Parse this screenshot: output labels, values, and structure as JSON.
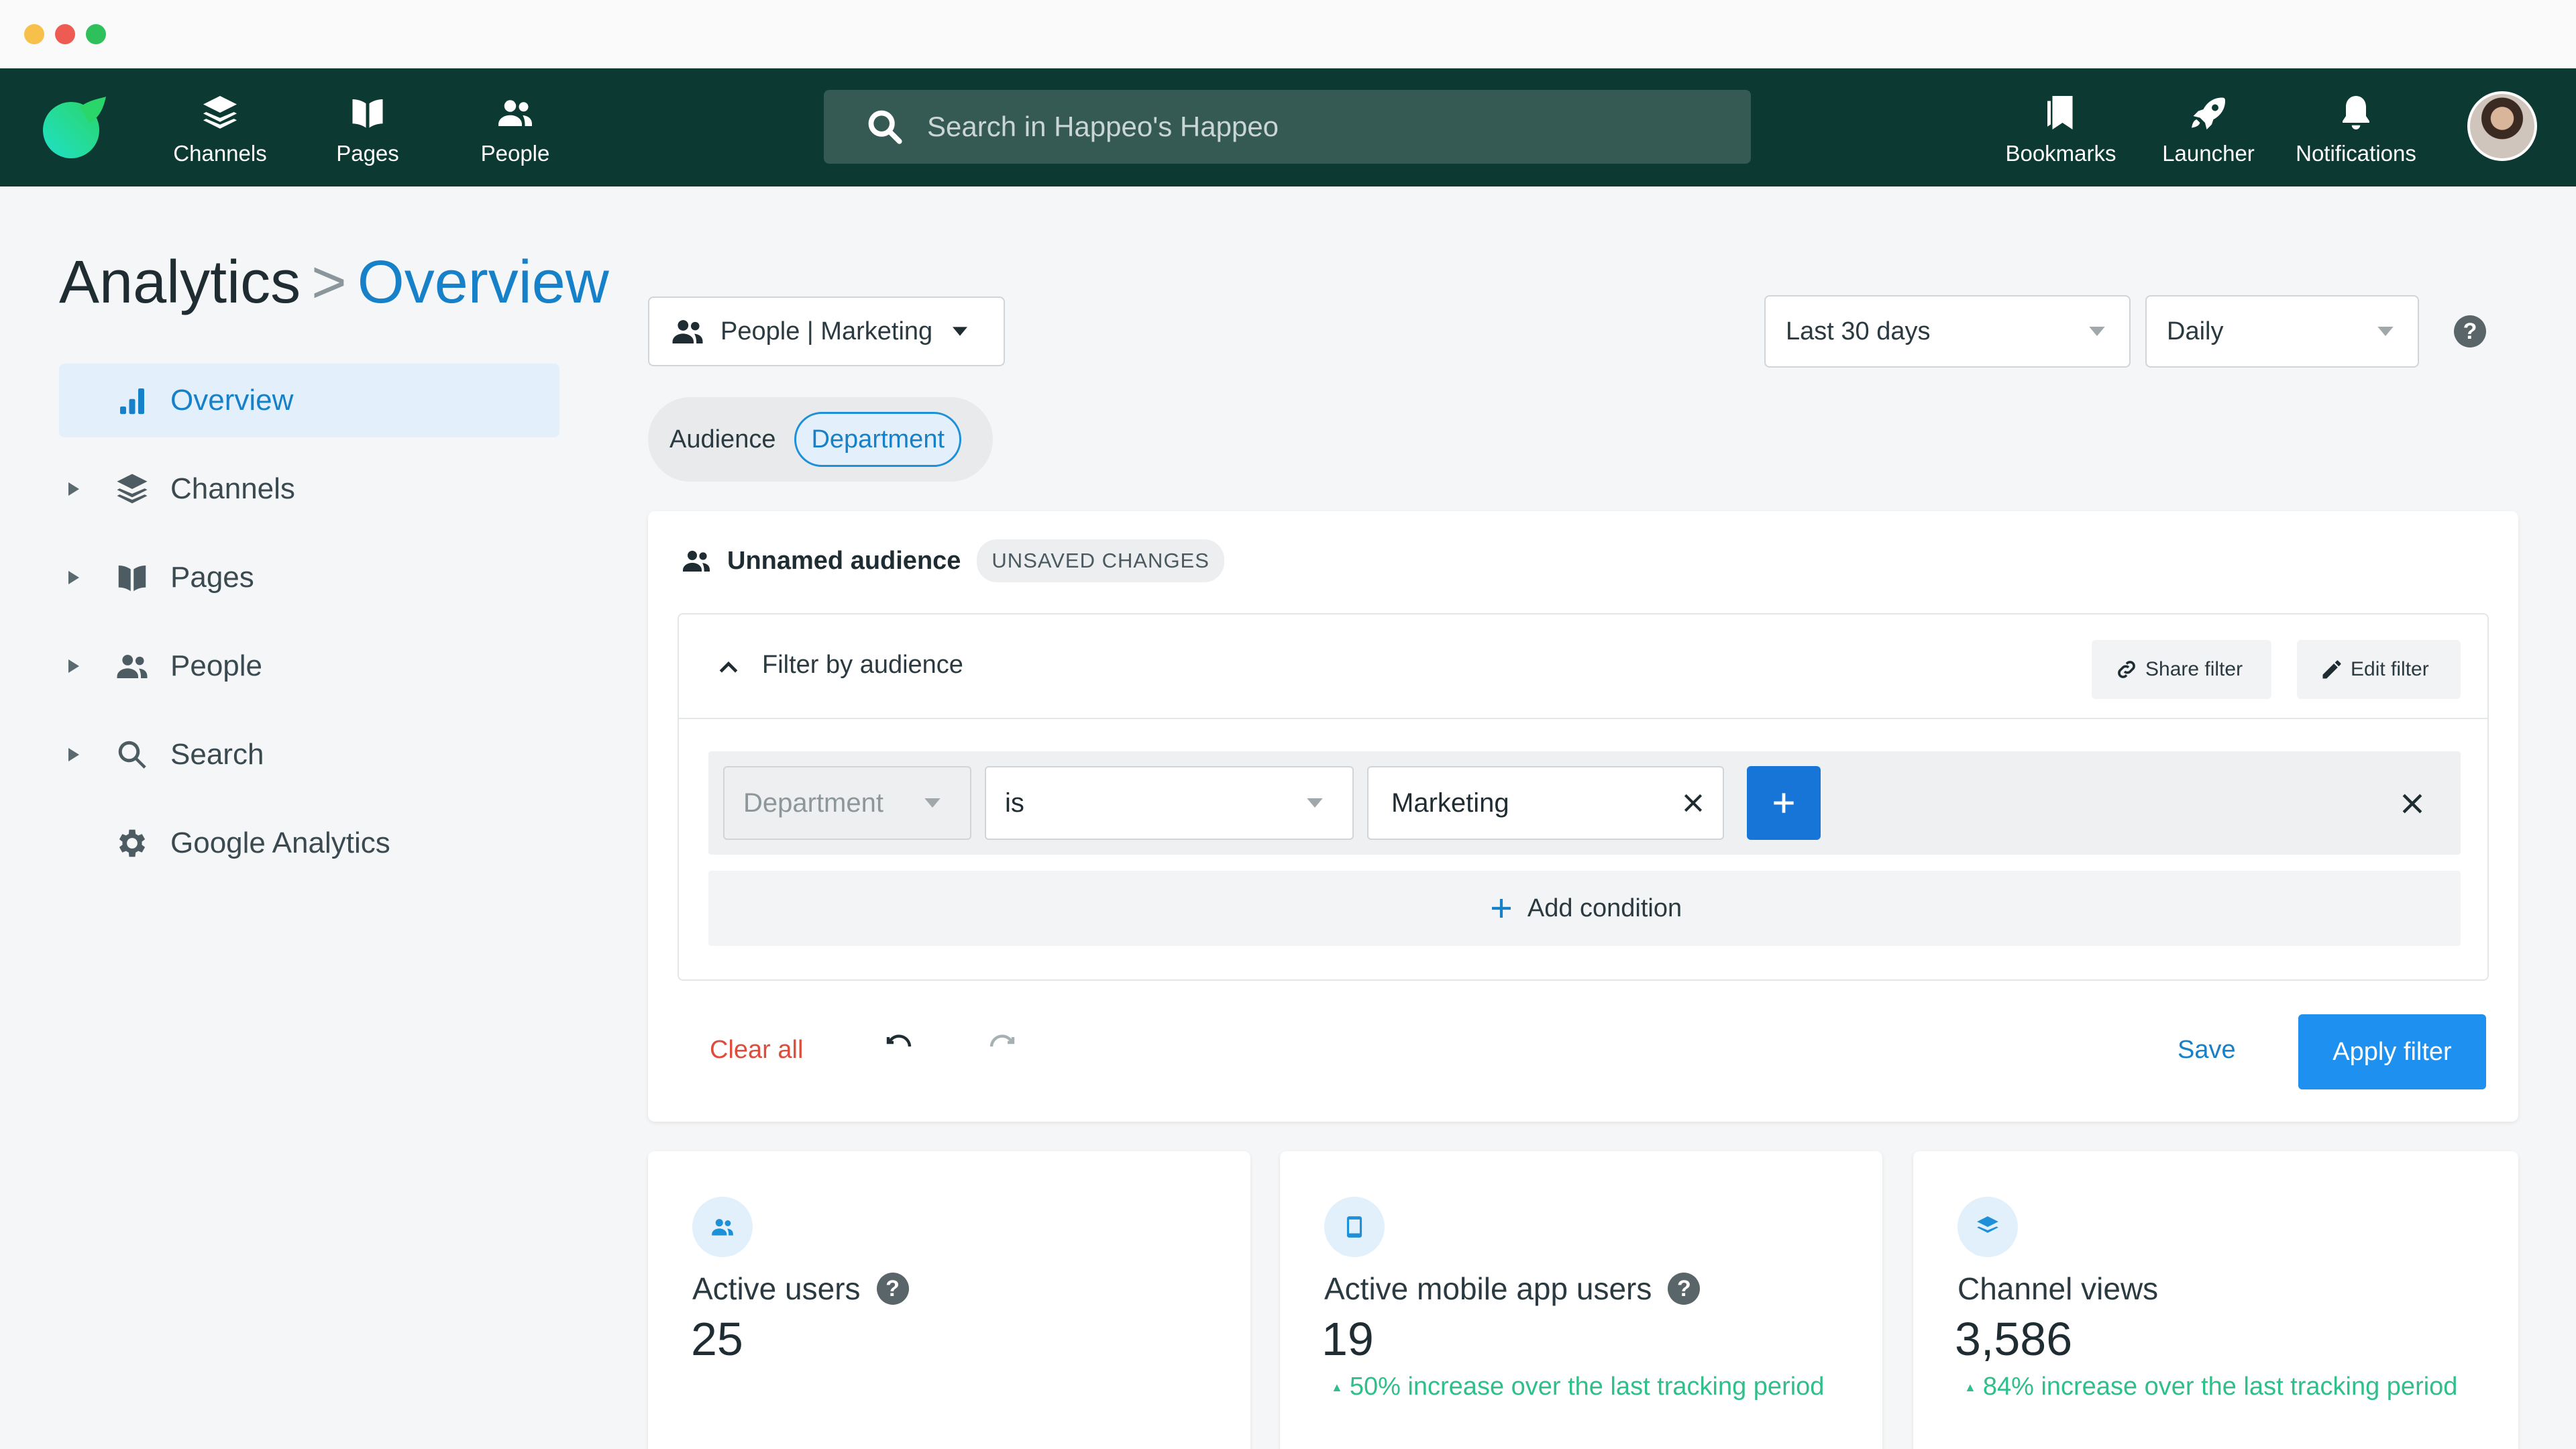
{
  "nav": {
    "items": [
      {
        "label": "Channels",
        "icon": "layers-icon"
      },
      {
        "label": "Pages",
        "icon": "book-icon"
      },
      {
        "label": "People",
        "icon": "people-icon"
      }
    ],
    "search_placeholder": "Search in Happeo's Happeo",
    "right_items": [
      {
        "label": "Bookmarks",
        "icon": "bookmark-icon"
      },
      {
        "label": "Launcher",
        "icon": "rocket-icon"
      },
      {
        "label": "Notifications",
        "icon": "bell-icon"
      }
    ]
  },
  "page": {
    "breadcrumb_root": "Analytics",
    "breadcrumb_sep": ">",
    "breadcrumb_current": "Overview"
  },
  "sidebar": {
    "items": [
      {
        "label": "Overview",
        "icon": "bar-chart-icon",
        "active": true
      },
      {
        "label": "Channels",
        "icon": "layers-icon"
      },
      {
        "label": "Pages",
        "icon": "book-icon"
      },
      {
        "label": "People",
        "icon": "people-icon"
      },
      {
        "label": "Search",
        "icon": "search-icon"
      },
      {
        "label": "Google Analytics",
        "icon": "gear-icon"
      }
    ]
  },
  "controls": {
    "scope_select": "People | Marketing",
    "range_select": "Last 30 days",
    "interval_select": "Daily",
    "segment": {
      "audience": "Audience",
      "department": "Department"
    }
  },
  "audience_card": {
    "name": "Unnamed audience",
    "badge": "UNSAVED CHANGES",
    "filter_title": "Filter by audience",
    "share_filter": "Share filter",
    "edit_filter": "Edit filter",
    "condition": {
      "field": "Department",
      "operator": "is",
      "value": "Marketing"
    },
    "add_condition": "Add condition",
    "clear_all": "Clear all",
    "save": "Save",
    "apply": "Apply filter"
  },
  "stats": [
    {
      "label": "Active users",
      "value": "25",
      "trend": "",
      "help": true,
      "icon": "users-icon"
    },
    {
      "label": "Active mobile app users",
      "value": "19",
      "trend": "50% increase over the last tracking period",
      "help": true,
      "icon": "phone-icon"
    },
    {
      "label": "Channel views",
      "value": "3,586",
      "trend": "84% increase over the last tracking period",
      "help": false,
      "icon": "layers-icon"
    }
  ],
  "colors": {
    "nav_bg": "#0c3a33",
    "accent": "#1680c8",
    "primary_button": "#1e90f0",
    "danger": "#e04c3c",
    "success": "#2fbf8a"
  }
}
